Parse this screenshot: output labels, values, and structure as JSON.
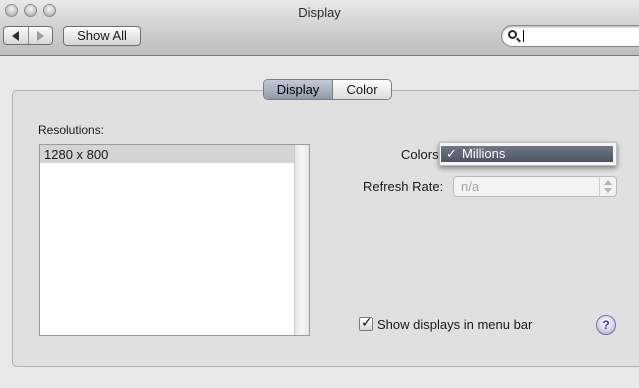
{
  "window": {
    "title": "Display"
  },
  "toolbar": {
    "back_icon": "back-arrow-icon",
    "forward_icon": "forward-arrow-icon",
    "show_all_label": "Show All",
    "search_placeholder": "",
    "search_value": ""
  },
  "tabs": [
    {
      "label": "Display",
      "selected": true
    },
    {
      "label": "Color",
      "selected": false
    }
  ],
  "resolutions": {
    "label": "Resolutions:",
    "items": [
      {
        "label": "1280 x 800",
        "selected": true
      }
    ]
  },
  "colors": {
    "label": "Colors",
    "check": "✓",
    "selected_value": "Millions"
  },
  "refresh_rate": {
    "label": "Refresh Rate:",
    "value": "n/a",
    "enabled": false
  },
  "menu_bar_option": {
    "label": "Show displays in menu bar",
    "checked": true,
    "check": "✓"
  },
  "help": {
    "label": "?"
  },
  "colors_theme": {
    "selection_blue": "#5a6272",
    "toolbar_gray": "#c9c9c9",
    "help_purple": "#4a3b86"
  }
}
